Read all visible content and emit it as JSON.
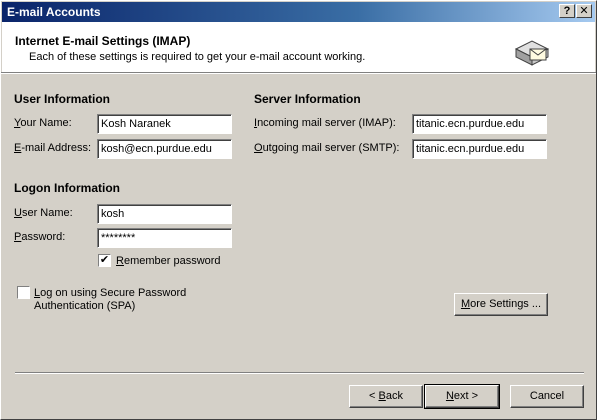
{
  "window": {
    "title": "E-mail Accounts",
    "help_btn": "?",
    "close_btn": "✕"
  },
  "header": {
    "title": "Internet E-mail Settings (IMAP)",
    "subtitle": "Each of these settings is required to get your e-mail account working.",
    "icon": "envelope-server-icon"
  },
  "user_info": {
    "heading": "User Information",
    "name_label_key": "Y",
    "name_label_rest": "our Name:",
    "name_value": "Kosh Naranek",
    "email_label_key": "E",
    "email_label_rest": "-mail Address:",
    "email_value": "kosh@ecn.purdue.edu"
  },
  "server_info": {
    "heading": "Server Information",
    "incoming_label_key": "I",
    "incoming_label_rest": "ncoming mail server (IMAP):",
    "incoming_value": "titanic.ecn.purdue.edu",
    "outgoing_label_key": "O",
    "outgoing_label_rest": "utgoing mail server (SMTP):",
    "outgoing_value": "titanic.ecn.purdue.edu"
  },
  "logon_info": {
    "heading": "Logon Information",
    "user_label_key": "U",
    "user_label_rest": "ser Name:",
    "user_value": "kosh",
    "pass_label_key": "P",
    "pass_label_rest": "assword:",
    "pass_value": "********",
    "remember_key": "R",
    "remember_rest": "emember password",
    "remember_checked": "✔",
    "spa_key": "L",
    "spa_line1_rest": "og on using Secure Password",
    "spa_line2": "Authentication (SPA)"
  },
  "buttons": {
    "more_settings_key": "M",
    "more_settings_rest": "ore Settings ...",
    "back_prefix": "< ",
    "back_key": "B",
    "back_rest": "ack",
    "next_key": "N",
    "next_rest": "ext >",
    "cancel": "Cancel"
  }
}
